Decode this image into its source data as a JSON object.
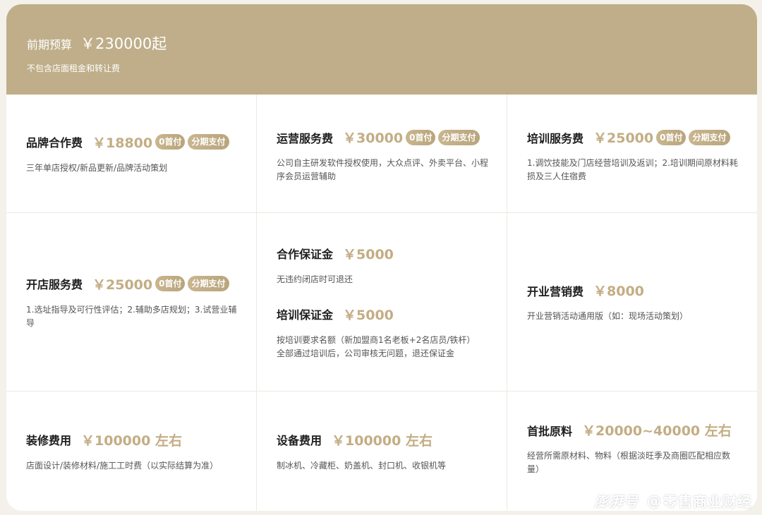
{
  "header": {
    "budget_label": "前期预算",
    "budget_amount": "￥230000起",
    "note": "不包含店面租金和转让费"
  },
  "badges": {
    "zero_down": "0首付",
    "installment": "分期支付"
  },
  "items": {
    "brand": {
      "title": "品牌合作费",
      "price": "￥18800",
      "desc": "三年单店授权/新品更新/品牌活动策划"
    },
    "operation": {
      "title": "运营服务费",
      "price": "￥30000",
      "desc": "公司自主研发软件授权使用，大众点评、外卖平台、小程序会员运营辅助"
    },
    "training_service": {
      "title": "培训服务费",
      "price": "￥25000",
      "desc": "1.调饮技能及门店经营培训及返训；2.培训期间原材料耗损及三人住宿费"
    },
    "opening_service": {
      "title": "开店服务费",
      "price": "￥25000",
      "desc": "1.选址指导及可行性评估；2.辅助多店规划；3.试营业辅导"
    },
    "coop_deposit": {
      "title": "合作保证金",
      "price": "￥5000",
      "desc": "无违约闭店时可退还"
    },
    "training_deposit": {
      "title": "培训保证金",
      "price": "￥5000",
      "desc_line1": "按培训要求名额（新加盟商1名老板+2名店员/铁杆）",
      "desc_line2": "全部通过培训后，公司审核无问题，退还保证金"
    },
    "marketing": {
      "title": "开业营销费",
      "price": "￥8000",
      "desc": "开业营销活动通用版（如：现场活动策划）"
    },
    "renovation": {
      "title": "装修费用",
      "price": "￥100000 左右",
      "desc": "店面设计/装修材料/施工工时费（以实际结算为准）"
    },
    "equipment": {
      "title": "设备费用",
      "price": "￥100000 左右",
      "desc": "制冰机、冷藏柜、奶盖机、封口机、收银机等"
    },
    "materials": {
      "title": "首批原料",
      "price": "￥20000~40000 左右",
      "desc": "经营所需原材料、物料（根据淡旺季及商圈匹配相应数量）"
    }
  },
  "watermark": {
    "logo": "澎湃号",
    "at": "@",
    "account": "零售商业财经"
  }
}
